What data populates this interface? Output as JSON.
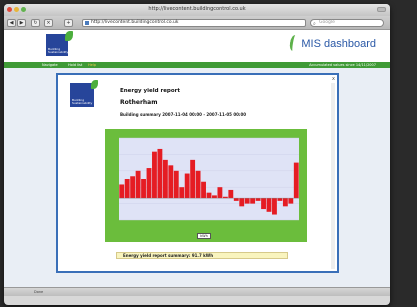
{
  "browser": {
    "window_title": "http://livecontent.buildingcontrol.co.uk",
    "address": "http://livecontent.buildingcontrol.co.uk",
    "search_placeholder": "Google",
    "status_text": "Done",
    "status_right": ""
  },
  "site": {
    "logo_text": "Building Sustainability",
    "dashboard_title": "MIS dashboard",
    "nav": [
      {
        "label": "Navigate"
      },
      {
        "label": "Hold list"
      },
      {
        "label": "Help"
      }
    ],
    "nav_right": "Accumulated values since 14/11/2007"
  },
  "report": {
    "logo_text": "Building Sustainability",
    "title": "Energy yield report",
    "site_name": "Rotherham",
    "summary": "Building summary 2007-11-04 00:00 - 2007-11-05 00:00",
    "chart_control": "kWh",
    "energy_summary": "Energy yield report summary:  91.7 kWh",
    "close_label": "x"
  },
  "chart_data": {
    "type": "bar",
    "title": "",
    "xlabel": "",
    "ylabel": "",
    "ylim": [
      -8,
      22
    ],
    "bar_color": "#e51c23",
    "background": "#dfe3f6",
    "frame_color": "#6bbd3c",
    "values": [
      5,
      7,
      8,
      10,
      7,
      11,
      17,
      18,
      14,
      12,
      10,
      4,
      9,
      14,
      10,
      6,
      2,
      1,
      4,
      0.5,
      3,
      -1,
      -3,
      -2,
      -2,
      -1,
      -4,
      -5,
      -6,
      -1,
      -3,
      -2,
      13
    ]
  }
}
